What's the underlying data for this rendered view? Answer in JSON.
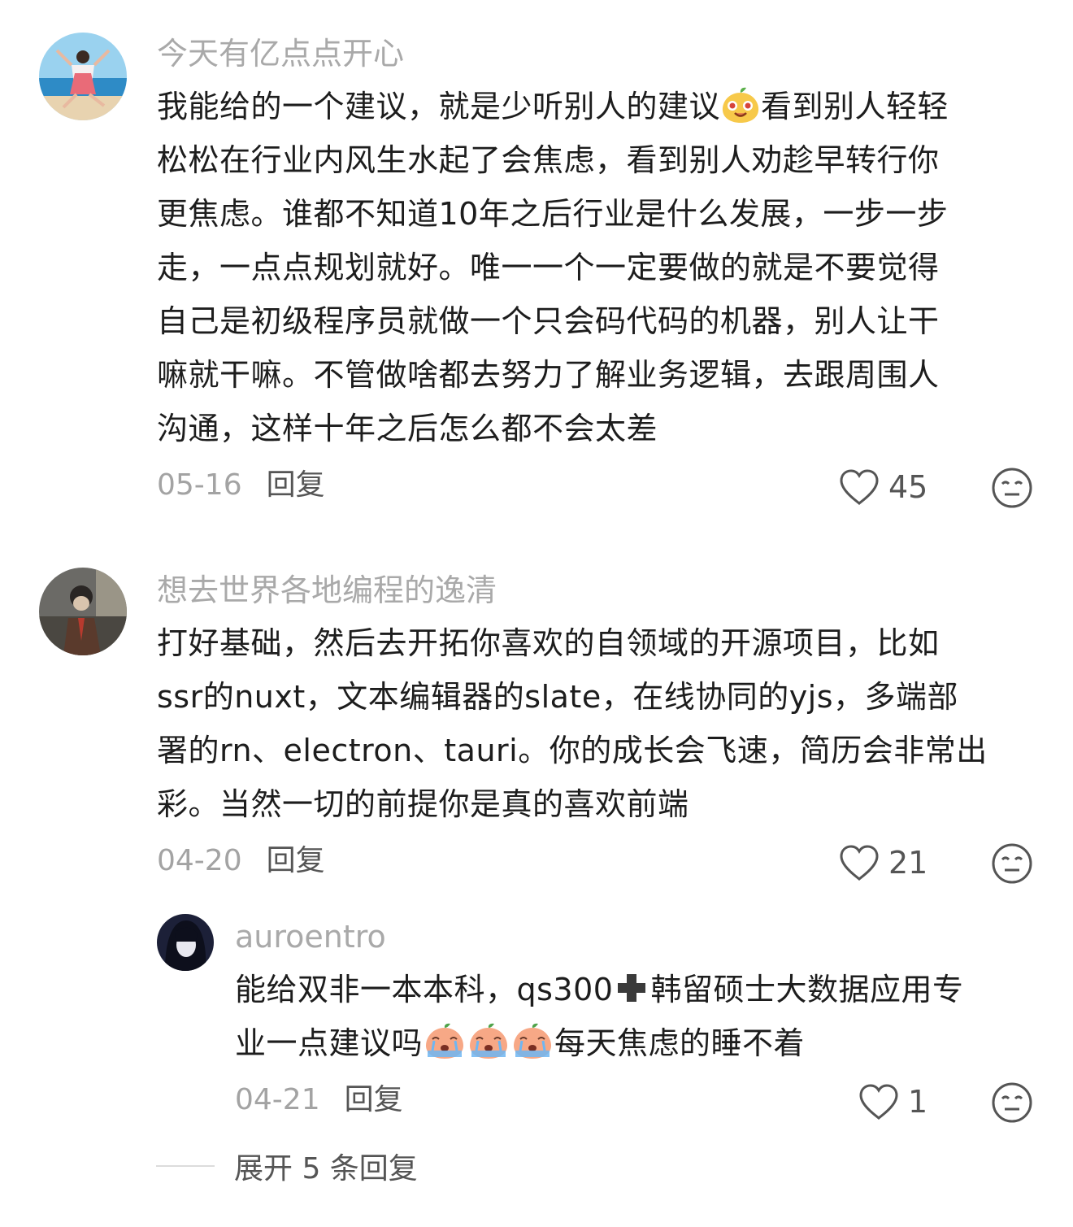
{
  "comments": [
    {
      "username": "今天有亿点点开心",
      "lines": [
        "我能给的一个建议，就是少听别人的建议",
        "看到别人轻轻",
        "松松在行业内风生水起了会焦虑，看到别人劝趁早转行你",
        "更焦虑。谁都不知道10年之后行业是什么发展，一步一步",
        "走，一点点规划就好。唯一一个一定要做的就是不要觉得",
        "自己是初级程序员就做一个只会码代码的机器，别人让干",
        "嘛就干嘛。不管做啥都去努力了解业务逻辑，去跟周围人",
        "沟通，这样十年之后怎么都不会太差"
      ],
      "date": "05-16",
      "reply_label": "回复",
      "likes": "45"
    },
    {
      "username": "想去世界各地编程的逸清",
      "lines": [
        "打好基础，然后去开拓你喜欢的自领域的开源项目，比如",
        "ssr的nuxt，文本编辑器的slate，在线协同的yjs，多端部",
        "署的rn、electron、tauri。你的成长会飞速，简历会非常出",
        "彩。当然一切的前提你是真的喜欢前端"
      ],
      "date": "04-20",
      "reply_label": "回复",
      "likes": "21"
    }
  ],
  "reply": {
    "username": "auroentro",
    "line1a": "能给双非一本本科，qs300",
    "line1b": "韩留硕士大数据应用专",
    "line2a": "业一点建议吗",
    "line2b": "每天焦虑的睡不着",
    "date": "04-21",
    "reply_label": "回复",
    "likes": "1"
  },
  "expand_label": "展开 5 条回复",
  "icons": {
    "like": "heart-outline-icon",
    "dislike": "meh-face-icon",
    "emoji_1": "smiling-mango-emoji",
    "emoji_2": "crying-peach-emoji",
    "plus": "heavy-plus-emoji"
  },
  "colors": {
    "username": "#a9a9a9",
    "body": "#1d1d1d",
    "meta": "#a3a3a3",
    "icon": "#555555"
  }
}
